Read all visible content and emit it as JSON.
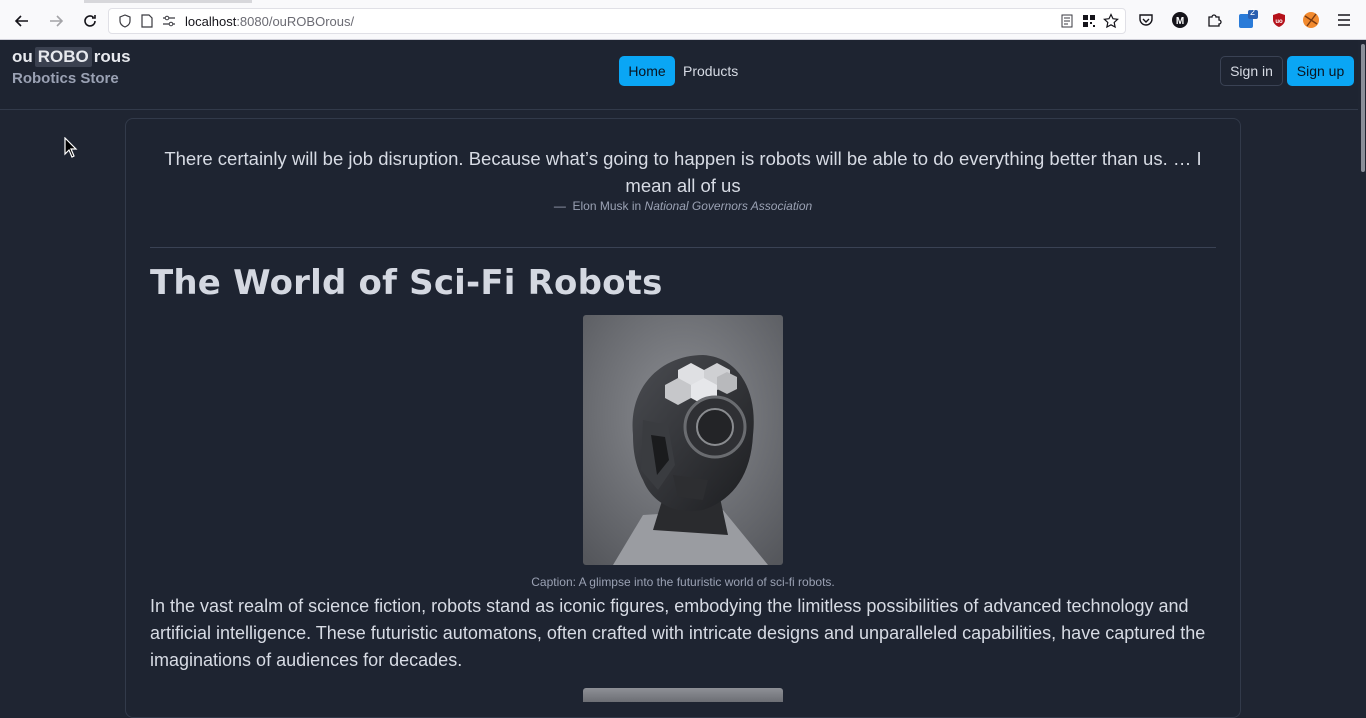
{
  "browser": {
    "url_host": "localhost",
    "url_rest": ":8080/ouROBOrous/",
    "extension_badge": "2"
  },
  "site": {
    "brand_prefix": "ou",
    "brand_highlight": "ROBO",
    "brand_suffix": "rous",
    "tagline": "Robotics Store",
    "nav": {
      "home": "Home",
      "products": "Products"
    },
    "auth": {
      "signin": "Sign in",
      "signup": "Sign up"
    },
    "accent_color": "#0aa6f5"
  },
  "content": {
    "quote": "There certainly will be job disruption. Because what’s going to happen is robots will be able to do everything better than us. … I mean all of us",
    "quote_dash": "—",
    "quote_author": "Elon Musk in",
    "quote_source": "National Governors Association",
    "heading": "The World of Sci-Fi Robots",
    "caption": "Caption: A glimpse into the futuristic world of sci-fi robots.",
    "paragraph": "In the vast realm of science fiction, robots stand as iconic figures, embodying the limitless possibilities of advanced technology and artificial intelligence. These futuristic automatons, often crafted with intricate designs and unparalleled capabilities, have captured the imaginations of audiences for decades."
  }
}
